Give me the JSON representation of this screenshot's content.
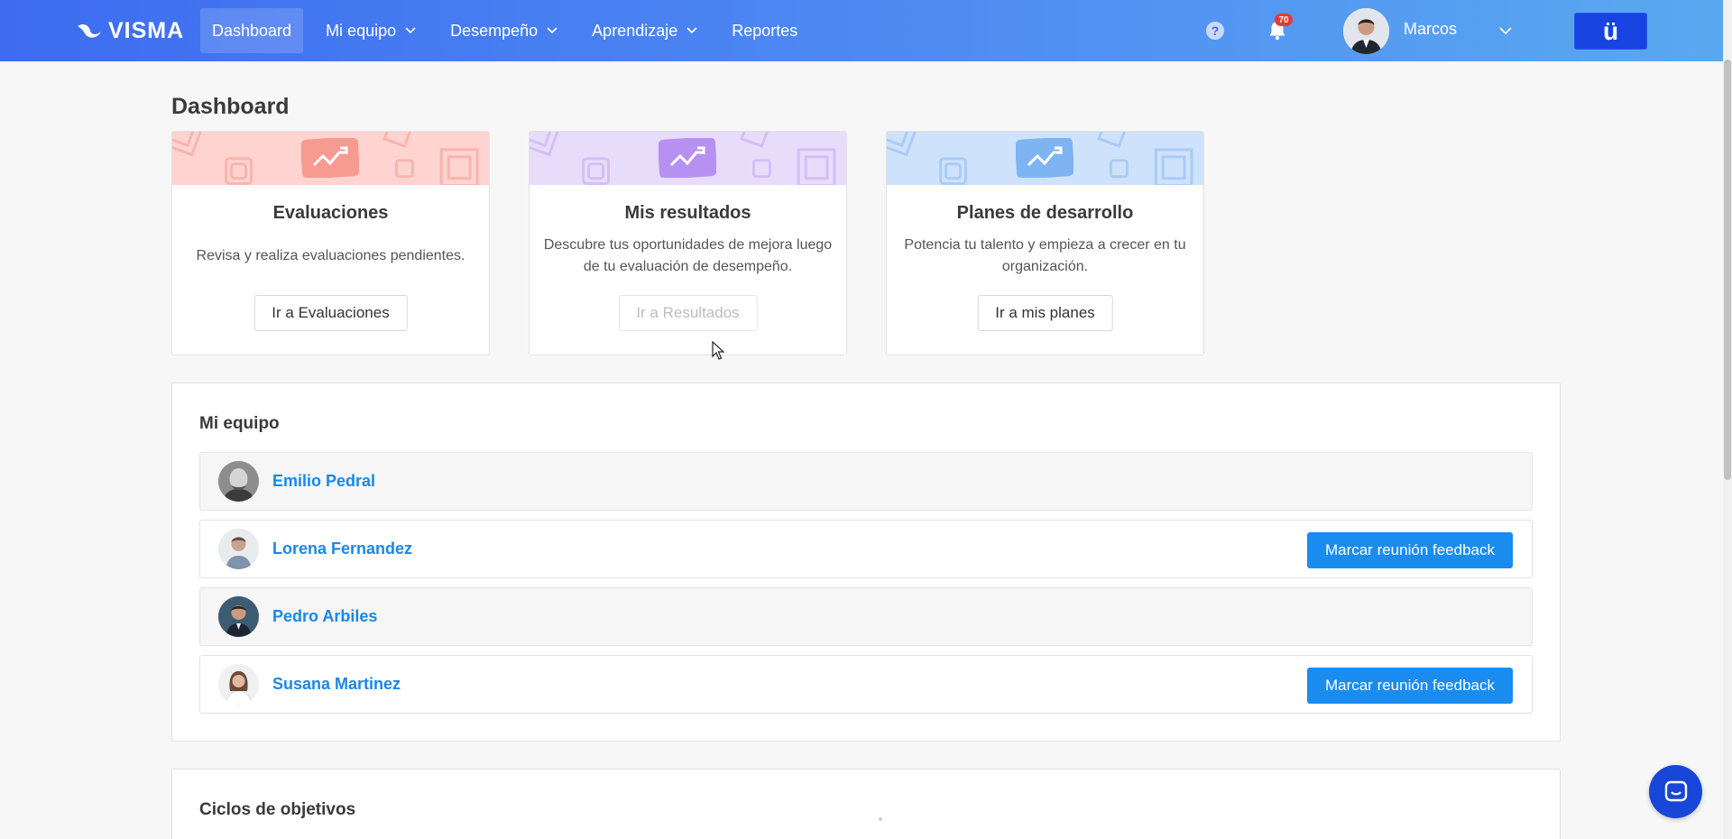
{
  "header": {
    "logo_text": "VISMA",
    "nav": [
      {
        "label": "Dashboard",
        "active": true,
        "has_dropdown": false
      },
      {
        "label": "Mi equipo",
        "active": false,
        "has_dropdown": true
      },
      {
        "label": "Desempeño",
        "active": false,
        "has_dropdown": true
      },
      {
        "label": "Aprendizaje",
        "active": false,
        "has_dropdown": true
      },
      {
        "label": "Reportes",
        "active": false,
        "has_dropdown": false
      }
    ],
    "help_icon": "?",
    "notification_count": "70",
    "user_name": "Marcos",
    "brand_button": "ü"
  },
  "page": {
    "title": "Dashboard"
  },
  "cards": [
    {
      "title": "Evaluaciones",
      "description": "Revisa y realiza evaluaciones pendientes.",
      "button": "Ir a Evaluaciones",
      "button_disabled": false,
      "color": "#ffd4d0",
      "accent": "#f79a90"
    },
    {
      "title": "Mis resultados",
      "description": "Descubre tus oportunidades de mejora luego de tu evaluación de desempeño.",
      "button": "Ir a Resultados",
      "button_disabled": true,
      "color": "#e8dcfb",
      "accent": "#b791f1"
    },
    {
      "title": "Planes de desarrollo",
      "description": "Potencia tu talento y empieza a crecer en tu organización.",
      "button": "Ir a mis planes",
      "button_disabled": false,
      "color": "#cfe2fb",
      "accent": "#7fb4f3"
    }
  ],
  "team": {
    "title": "Mi equipo",
    "members": [
      {
        "name": "Emilio Pedral",
        "action": null
      },
      {
        "name": "Lorena Fernandez",
        "action": "Marcar reunión feedback"
      },
      {
        "name": "Pedro Arbiles",
        "action": null
      },
      {
        "name": "Susana Martinez",
        "action": "Marcar reunión feedback"
      }
    ]
  },
  "objectives": {
    "title": "Ciclos de objetivos"
  },
  "colors": {
    "primary": "#1a8cf0",
    "link": "#1a87e8",
    "header_start": "#3d6cf0",
    "header_end": "#5aa9f0",
    "brand": "#1744e0"
  }
}
